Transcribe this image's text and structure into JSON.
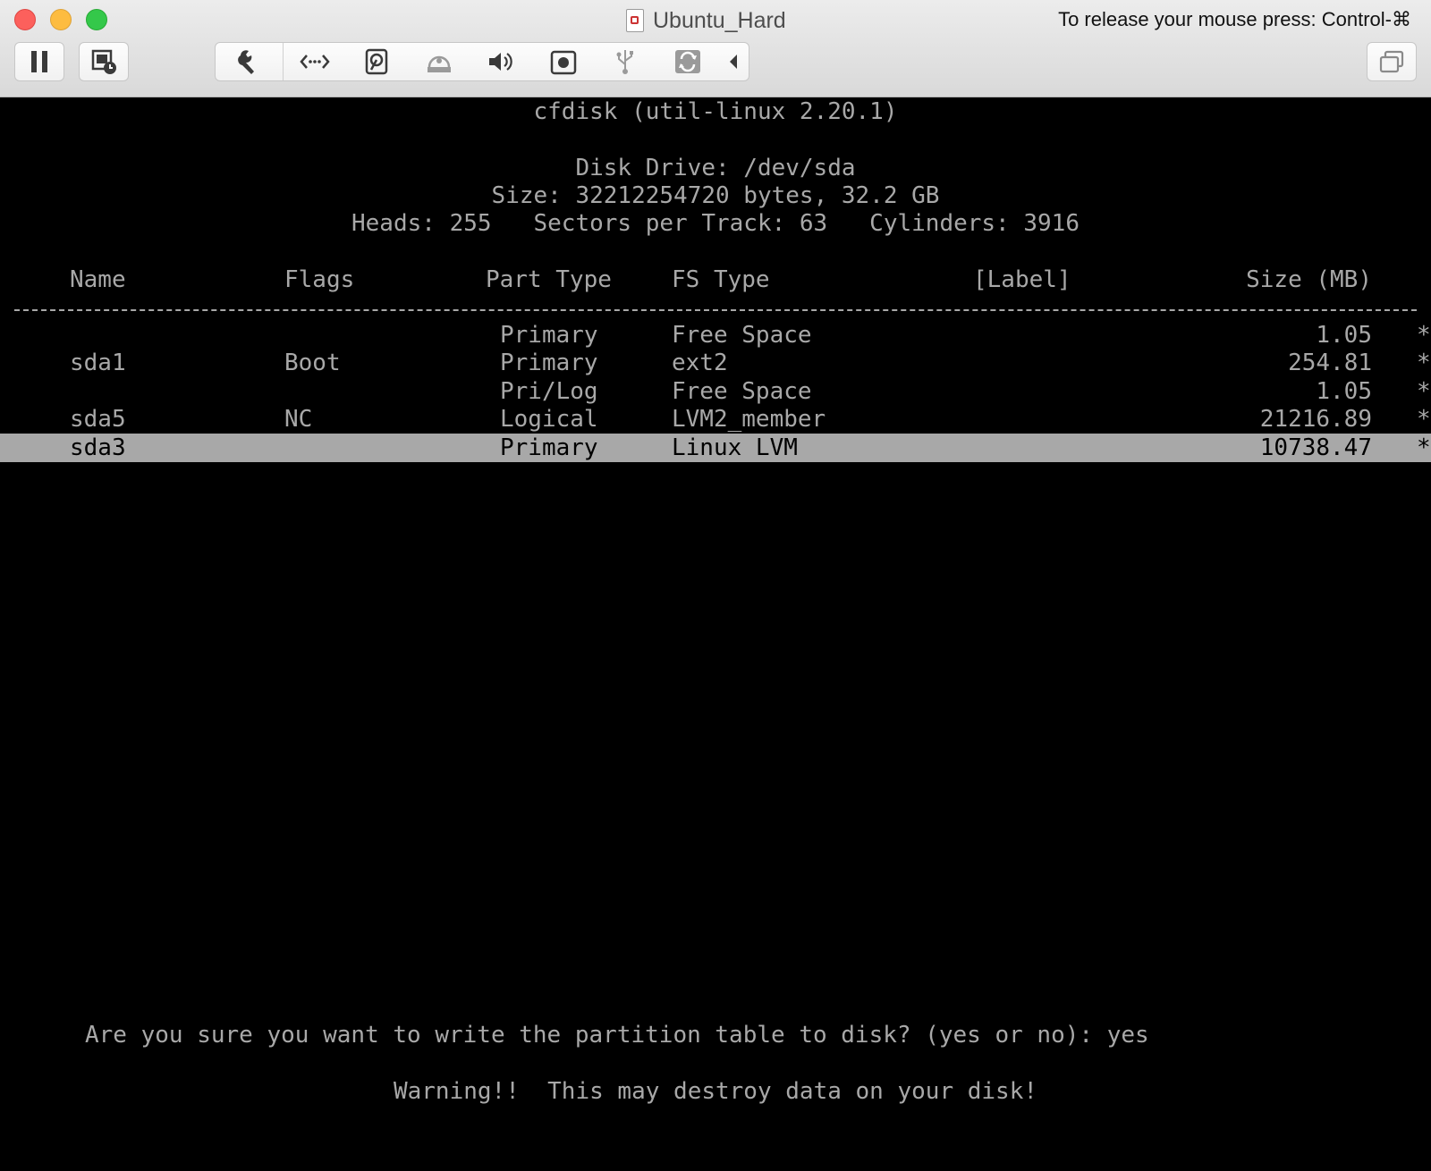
{
  "window": {
    "title": "Ubuntu_Hard",
    "release_hint": "To release your mouse press: Control-⌘"
  },
  "toolbar": {
    "left_buttons": [
      "pause-icon",
      "snapshot-icon"
    ],
    "group_icons": [
      "wrench-icon",
      "network-icon",
      "hard-disk-icon",
      "optical-drive-icon",
      "sound-icon",
      "camera-icon",
      "usb-icon",
      "sharing-icon",
      "collapse-arrow-icon"
    ],
    "right_button": "fullscreen-icon"
  },
  "terminal": {
    "app_title": "cfdisk (util-linux 2.20.1)",
    "disk_drive": "Disk Drive: /dev/sda",
    "size_line": "Size: 32212254720 bytes, 32.2 GB",
    "geometry_line": "Heads: 255   Sectors per Track: 63   Cylinders: 3916",
    "columns": {
      "name": "Name",
      "flags": "Flags",
      "part_type": "Part Type",
      "fs_type": "FS Type",
      "label": "[Label]",
      "size": "Size (MB)"
    },
    "partitions": [
      {
        "name": "",
        "flags": "",
        "part_type": "Primary",
        "fs_type": "Free Space",
        "label": "",
        "size": "1.05",
        "marker": "*"
      },
      {
        "name": "sda1",
        "flags": "Boot",
        "part_type": "Primary",
        "fs_type": "ext2",
        "label": "",
        "size": "254.81",
        "marker": "*"
      },
      {
        "name": "",
        "flags": "",
        "part_type": "Pri/Log",
        "fs_type": "Free Space",
        "label": "",
        "size": "1.05",
        "marker": "*"
      },
      {
        "name": "sda5",
        "flags": "NC",
        "part_type": "Logical",
        "fs_type": "LVM2_member",
        "label": "",
        "size": "21216.89",
        "marker": "*"
      },
      {
        "name": "sda3",
        "flags": "",
        "part_type": "Primary",
        "fs_type": "Linux LVM",
        "label": "",
        "size": "10738.47",
        "marker": "*",
        "selected": true
      }
    ],
    "prompt": "Are you sure you want to write the partition table to disk? (yes or no): yes",
    "warning": "Warning!!  This may destroy data on your disk!"
  },
  "colors": {
    "terminal_bg": "#000000",
    "terminal_fg": "#a8a8a8",
    "selected_row_bg": "#a8a8a8"
  }
}
